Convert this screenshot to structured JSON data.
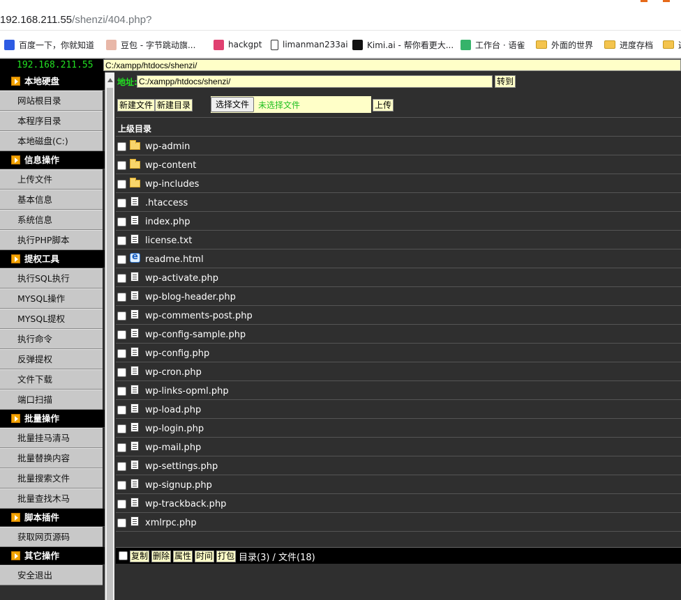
{
  "browser": {
    "url_host": "192.168.211.55",
    "url_path": "/shenzi/404.php?",
    "bookmarks": [
      {
        "label": "百度一下，你就知道",
        "icon": "baidu-icon"
      },
      {
        "label": "豆包 - 字节跳动旗...",
        "icon": "doubao-icon"
      },
      {
        "label": "hackgpt",
        "icon": "hackgpt-icon"
      },
      {
        "label": "limanman233ai",
        "icon": "document-icon"
      },
      {
        "label": "Kimi.ai - 帮你看更大...",
        "icon": "kimi-icon"
      },
      {
        "label": "工作台 · 语雀",
        "icon": "yuque-icon"
      },
      {
        "label": "外面的世界",
        "icon": "folder-icon"
      },
      {
        "label": "进度存档",
        "icon": "folder-icon"
      },
      {
        "label": "这",
        "icon": "folder-icon"
      }
    ]
  },
  "shell": {
    "server_ip": "192.168.211.55",
    "top_path": "C:/xampp/htdocs/shenzi/",
    "sections": [
      {
        "title": "本地硬盘",
        "items": [
          "网站根目录",
          "本程序目录",
          "本地磁盘(C:)"
        ]
      },
      {
        "title": "信息操作",
        "items": [
          "上传文件",
          "基本信息",
          "系统信息",
          "执行PHP脚本"
        ]
      },
      {
        "title": "提权工具",
        "items": [
          "执行SQL执行",
          "MYSQL操作",
          "MYSQL提权",
          "执行命令",
          "反弹提权",
          "文件下载",
          "端口扫描"
        ]
      },
      {
        "title": "批量操作",
        "items": [
          "批量挂马清马",
          "批量替换内容",
          "批量搜索文件",
          "批量查找木马"
        ]
      },
      {
        "title": "脚本插件",
        "items": [
          "获取网页源码"
        ]
      },
      {
        "title": "其它操作",
        "items": [
          "安全退出"
        ]
      }
    ],
    "address_label": "地址:",
    "address_value": "C:/xampp/htdocs/shenzi/",
    "goto_label": "转到",
    "new_file_label": "新建文件",
    "new_dir_label": "新建目录",
    "choose_file_label": "选择文件",
    "no_file_label": "未选择文件",
    "upload_label": "上传",
    "parent_dir_label": "上级目录",
    "entries": [
      {
        "name": "wp-admin",
        "type": "folder"
      },
      {
        "name": "wp-content",
        "type": "folder"
      },
      {
        "name": "wp-includes",
        "type": "folder"
      },
      {
        "name": ".htaccess",
        "type": "file"
      },
      {
        "name": "index.php",
        "type": "file"
      },
      {
        "name": "license.txt",
        "type": "file"
      },
      {
        "name": "readme.html",
        "type": "html"
      },
      {
        "name": "wp-activate.php",
        "type": "file"
      },
      {
        "name": "wp-blog-header.php",
        "type": "file"
      },
      {
        "name": "wp-comments-post.php",
        "type": "file"
      },
      {
        "name": "wp-config-sample.php",
        "type": "file"
      },
      {
        "name": "wp-config.php",
        "type": "file"
      },
      {
        "name": "wp-cron.php",
        "type": "file"
      },
      {
        "name": "wp-links-opml.php",
        "type": "file"
      },
      {
        "name": "wp-load.php",
        "type": "file"
      },
      {
        "name": "wp-login.php",
        "type": "file"
      },
      {
        "name": "wp-mail.php",
        "type": "file"
      },
      {
        "name": "wp-settings.php",
        "type": "file"
      },
      {
        "name": "wp-signup.php",
        "type": "file"
      },
      {
        "name": "wp-trackback.php",
        "type": "file"
      },
      {
        "name": "xmlrpc.php",
        "type": "file"
      }
    ],
    "bottom_buttons": [
      "复制",
      "删除",
      "属性",
      "时间",
      "打包"
    ],
    "summary": "目录(3) / 文件(18)"
  },
  "colors": {
    "panel_bg": "#2f2f2f",
    "input_bg": "#ffffc8",
    "ip_green": "#22e022",
    "section_arrow": "#f2a300"
  }
}
